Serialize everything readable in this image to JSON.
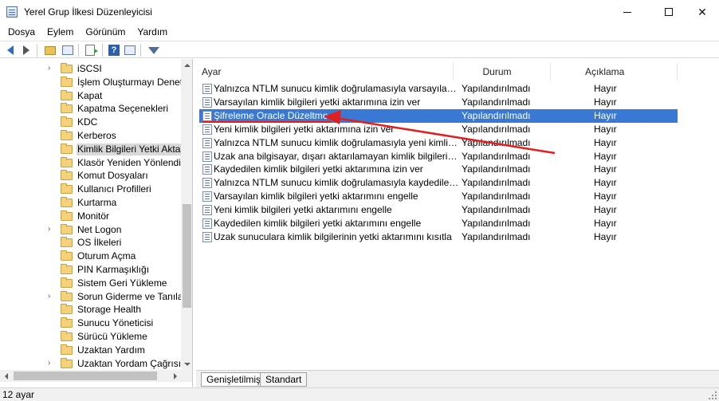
{
  "window": {
    "title": "Yerel Grup İlkesi Düzenleyicisi",
    "controls": [
      "minimize",
      "maximize",
      "close"
    ]
  },
  "menu": [
    "Dosya",
    "Eylem",
    "Görünüm",
    "Yardım"
  ],
  "toolbar": {
    "icons": [
      "back-arrow-icon",
      "forward-arrow-icon",
      "up-folder-icon",
      "show-hide-tree-icon",
      "export-list-icon",
      "help-icon",
      "properties-icon",
      "filter-icon"
    ]
  },
  "tree": {
    "items": [
      {
        "label": "iSCSI",
        "expandable": true,
        "selected": false
      },
      {
        "label": "İşlem Oluşturmayı Denetle",
        "expandable": false,
        "selected": false
      },
      {
        "label": "Kapat",
        "expandable": false,
        "selected": false
      },
      {
        "label": "Kapatma Seçenekleri",
        "expandable": false,
        "selected": false
      },
      {
        "label": "KDC",
        "expandable": false,
        "selected": false
      },
      {
        "label": "Kerberos",
        "expandable": false,
        "selected": false
      },
      {
        "label": "Kimlik Bilgileri Yetki Aktarı",
        "expandable": false,
        "selected": true
      },
      {
        "label": "Klasör Yeniden Yönlendirm",
        "expandable": false,
        "selected": false
      },
      {
        "label": "Komut Dosyaları",
        "expandable": false,
        "selected": false
      },
      {
        "label": "Kullanıcı Profilleri",
        "expandable": false,
        "selected": false
      },
      {
        "label": "Kurtarma",
        "expandable": false,
        "selected": false
      },
      {
        "label": "Monitör",
        "expandable": false,
        "selected": false
      },
      {
        "label": "Net Logon",
        "expandable": true,
        "selected": false
      },
      {
        "label": "OS İlkeleri",
        "expandable": false,
        "selected": false
      },
      {
        "label": "Oturum Açma",
        "expandable": false,
        "selected": false
      },
      {
        "label": "PIN Karmaşıklığı",
        "expandable": false,
        "selected": false
      },
      {
        "label": "Sistem Geri Yükleme",
        "expandable": false,
        "selected": false
      },
      {
        "label": "Sorun Giderme ve Tanılam",
        "expandable": true,
        "selected": false
      },
      {
        "label": "Storage Health",
        "expandable": false,
        "selected": false
      },
      {
        "label": "Sunucu Yöneticisi",
        "expandable": false,
        "selected": false
      },
      {
        "label": "Sürücü Yükleme",
        "expandable": false,
        "selected": false
      },
      {
        "label": "Uzaktan Yardım",
        "expandable": false,
        "selected": false
      },
      {
        "label": "Uzaktan Yordam Çağrısı",
        "expandable": true,
        "selected": false
      }
    ]
  },
  "list": {
    "columns": {
      "setting": "Ayar",
      "state": "Durum",
      "comment": "Açıklama"
    },
    "rows": [
      {
        "name": "Yalnızca NTLM sunucu kimlik doğrulamasıyla varsayılan kim...",
        "state": "Yapılandırılmadı",
        "comment": "Hayır",
        "selected": false
      },
      {
        "name": "Varsayılan kimlik bilgileri yetki aktarımına izin ver",
        "state": "Yapılandırılmadı",
        "comment": "Hayır",
        "selected": false
      },
      {
        "name": "Şifreleme Oracle Düzeltme",
        "state": "Yapılandırılmadı",
        "comment": "Hayır",
        "selected": true
      },
      {
        "name": "Yeni kimlik bilgileri yetki aktarımına izin ver",
        "state": "Yapılandırılmadı",
        "comment": "Hayır",
        "selected": false
      },
      {
        "name": "Yalnızca NTLM sunucu kimlik doğrulamasıyla yeni kimlik bil...",
        "state": "Yapılandırılmadı",
        "comment": "Hayır",
        "selected": false
      },
      {
        "name": "Uzak ana bilgisayar, dışarı aktarılamayan kimlik bilgilerinin v...",
        "state": "Yapılandırılmadı",
        "comment": "Hayır",
        "selected": false
      },
      {
        "name": "Kaydedilen kimlik bilgileri yetki aktarımına izin ver",
        "state": "Yapılandırılmadı",
        "comment": "Hayır",
        "selected": false
      },
      {
        "name": "Yalnızca NTLM sunucu kimlik doğrulamasıyla kaydedilen ki...",
        "state": "Yapılandırılmadı",
        "comment": "Hayır",
        "selected": false
      },
      {
        "name": "Varsayılan kimlik bilgileri yetki aktarımını engelle",
        "state": "Yapılandırılmadı",
        "comment": "Hayır",
        "selected": false
      },
      {
        "name": "Yeni kimlik bilgileri yetki aktarımını engelle",
        "state": "Yapılandırılmadı",
        "comment": "Hayır",
        "selected": false
      },
      {
        "name": "Kaydedilen kimlik bilgileri yetki aktarımını engelle",
        "state": "Yapılandırılmadı",
        "comment": "Hayır",
        "selected": false
      },
      {
        "name": "Uzak sunuculara kimlik bilgilerinin yetki aktarımını kısıtla",
        "state": "Yapılandırılmadı",
        "comment": "Hayır",
        "selected": false
      }
    ]
  },
  "tabs": [
    "Genişletilmiş",
    "Standart"
  ],
  "status": "12 ayar",
  "colors": {
    "selection": "#3a79d3",
    "annotation": "#e02020"
  }
}
